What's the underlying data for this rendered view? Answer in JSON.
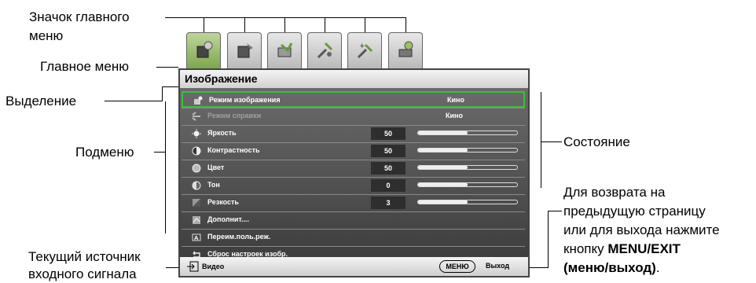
{
  "callouts": {
    "main_menu_icon": [
      "Значок главного",
      "меню"
    ],
    "main_menu": "Главное меню",
    "highlight": "Выделение",
    "submenu": "Подменю",
    "state": "Состояние",
    "current_source": [
      "Текущий источник",
      "входного сигнала"
    ],
    "back_exit_1": "Для возврата на",
    "back_exit_2": "предыдущую страницу",
    "back_exit_3": "или для выхода нажмите",
    "back_exit_4_prefix": "кнопку ",
    "back_exit_4_bold": "MENU/EXIT",
    "back_exit_5_bold": "(меню/выход)",
    "back_exit_5_suffix": "."
  },
  "tabs": [
    {
      "icon": "picture-tab-icon",
      "active": true
    },
    {
      "icon": "picture-advanced-tab-icon",
      "active": false
    },
    {
      "icon": "display-tab-icon",
      "active": false
    },
    {
      "icon": "settings-basic-tab-icon",
      "active": false
    },
    {
      "icon": "settings-advanced-tab-icon",
      "active": false
    },
    {
      "icon": "information-tab-icon",
      "active": false
    }
  ],
  "menu": {
    "title": "Изображение",
    "rows": [
      {
        "label": "Режим изображения",
        "value": "Кино",
        "icon": "picture-mode-icon",
        "selected": true
      },
      {
        "label": "Режим справки",
        "value": "Кино",
        "icon": "reference-mode-icon",
        "dim": true
      },
      {
        "label": "Яркость",
        "number": "50",
        "level": 0.5,
        "icon": "brightness-icon"
      },
      {
        "label": "Контрастность",
        "number": "50",
        "level": 0.5,
        "icon": "contrast-icon"
      },
      {
        "label": "Цвет",
        "number": "50",
        "level": 0.5,
        "icon": "color-icon"
      },
      {
        "label": "Тон",
        "number": "0",
        "level": 0.5,
        "icon": "tint-icon"
      },
      {
        "label": "Резкость",
        "number": "3",
        "level": 0.5,
        "icon": "sharpness-icon"
      },
      {
        "label": "Дополнит....",
        "icon": "advanced-icon"
      },
      {
        "label": "Переим.поль.реж.",
        "icon": "rename-user-mode-icon"
      },
      {
        "label": "Сброс настроек изобр.",
        "icon": "reset-picture-icon"
      }
    ],
    "footer": {
      "source": "Видео",
      "menu_button": "МЕНЮ",
      "exit": "Выход",
      "source_icon": "input-source-icon"
    }
  },
  "colors": {
    "selection": "#3bbf3b",
    "active_tab": "#8ab55a"
  }
}
